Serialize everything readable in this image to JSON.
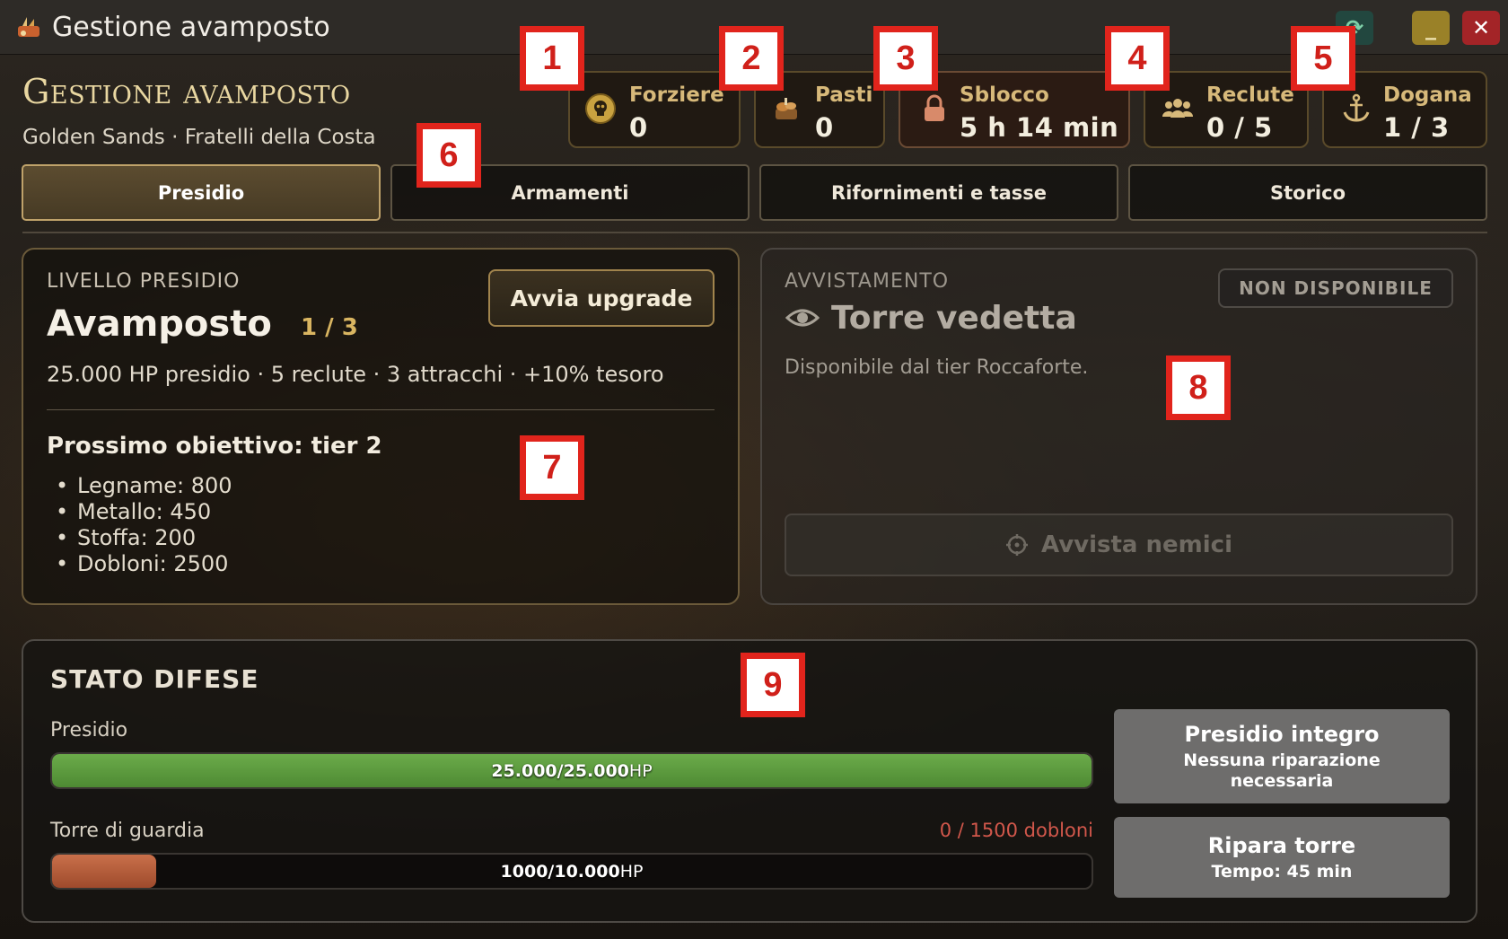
{
  "window": {
    "title": "Gestione avamposto"
  },
  "header": {
    "title": "Gestione avamposto",
    "subtitle": "Golden Sands · Fratelli della Costa"
  },
  "stats": [
    {
      "label": "Forziere",
      "value": "0",
      "icon": "skull-coin-icon"
    },
    {
      "label": "Pasti",
      "value": "0",
      "icon": "food-icon"
    },
    {
      "label": "Sblocco",
      "value": "5 h 14 min",
      "icon": "lock-icon"
    },
    {
      "label": "Reclute",
      "value": "0 / 5",
      "icon": "users-icon"
    },
    {
      "label": "Dogana",
      "value": "1 / 3",
      "icon": "anchor-icon"
    }
  ],
  "tabs": [
    "Presidio",
    "Armamenti",
    "Rifornimenti e tasse",
    "Storico"
  ],
  "presidio": {
    "eyebrow": "LIVELLO PRESIDIO",
    "name": "Avamposto",
    "level": "1 / 3",
    "upgrade_label": "Avvia upgrade",
    "stats": "25.000 HP presidio · 5 reclute · 3 attracchi · +10% tesoro",
    "next_title": "Prossimo obiettivo: tier 2",
    "requirements": [
      "Legname: 800",
      "Metallo: 450",
      "Stoffa: 200",
      "Dobloni: 2500"
    ]
  },
  "avvistamento": {
    "eyebrow": "AVVISTAMENTO",
    "badge": "NON DISPONIBILE",
    "name": "Torre vedetta",
    "description": "Disponibile dal tier Roccaforte.",
    "button_label": "Avvista nemici"
  },
  "difese": {
    "title": "STATO DIFESE",
    "bars": [
      {
        "label": "Presidio",
        "value": "25.000/25.000",
        "unit": "HP",
        "fill": 1.0,
        "color": "#5a9a3d",
        "cost": ""
      },
      {
        "label": "Torre di guardia",
        "value": "1000/10.000",
        "unit": "HP",
        "fill": 0.1,
        "color": "#b85c3a",
        "cost": "0 / 1500 dobloni"
      }
    ],
    "integro": {
      "title": "Presidio integro",
      "subtitle": "Nessuna riparazione necessaria"
    },
    "ripara": {
      "title": "Ripara torre",
      "subtitle": "Tempo: 45 min"
    }
  },
  "markers": [
    "1",
    "2",
    "3",
    "4",
    "5",
    "6",
    "7",
    "8",
    "9"
  ]
}
